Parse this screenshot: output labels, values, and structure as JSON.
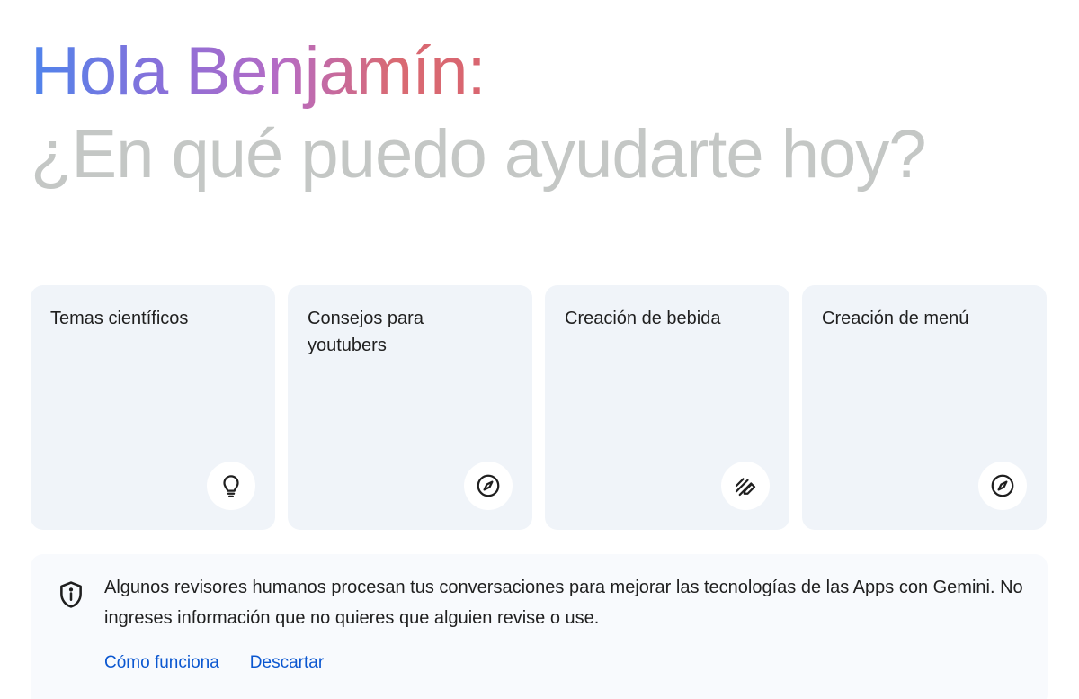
{
  "greeting": {
    "title": "Hola Benjamín:",
    "subtitle": "¿En qué puedo ayudarte hoy?"
  },
  "cards": [
    {
      "label": "Temas científicos",
      "icon": "lightbulb-icon"
    },
    {
      "label": "Consejos para youtubers",
      "icon": "compass-icon"
    },
    {
      "label": "Creación de bebida",
      "icon": "edit-pen-icon"
    },
    {
      "label": "Creación de menú",
      "icon": "compass-icon"
    }
  ],
  "notice": {
    "text": "Algunos revisores humanos procesan tus conversaciones para mejorar las tecnologías de las Apps con Gemini. No ingreses información que no quieres que alguien revise o use.",
    "icon": "shield-info-icon",
    "link_how": "Cómo funciona",
    "link_dismiss": "Descartar"
  },
  "colors": {
    "card_bg": "#f0f4f9",
    "subtitle": "#c4c7c5",
    "link": "#0b57d0",
    "gradient_start": "#4f84ec",
    "gradient_end": "#d96570"
  }
}
